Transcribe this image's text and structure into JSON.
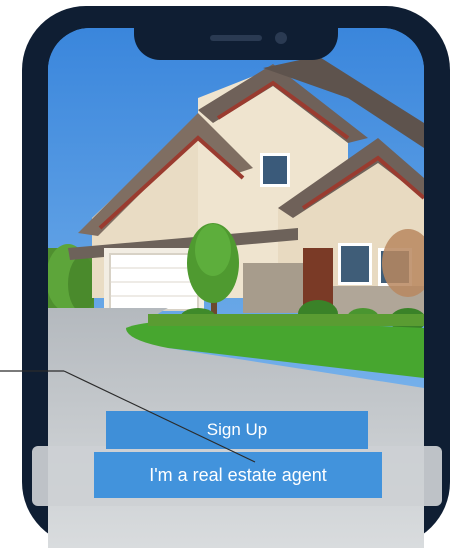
{
  "auth": {
    "signup_label": "Sign Up",
    "agent_label": "I'm a real estate agent"
  },
  "colors": {
    "phone_frame": "#0f1e33",
    "button": "#3f8fd8",
    "sky": "#4a93e2"
  },
  "background": {
    "subject": "suburban house with lawn and driveway"
  }
}
